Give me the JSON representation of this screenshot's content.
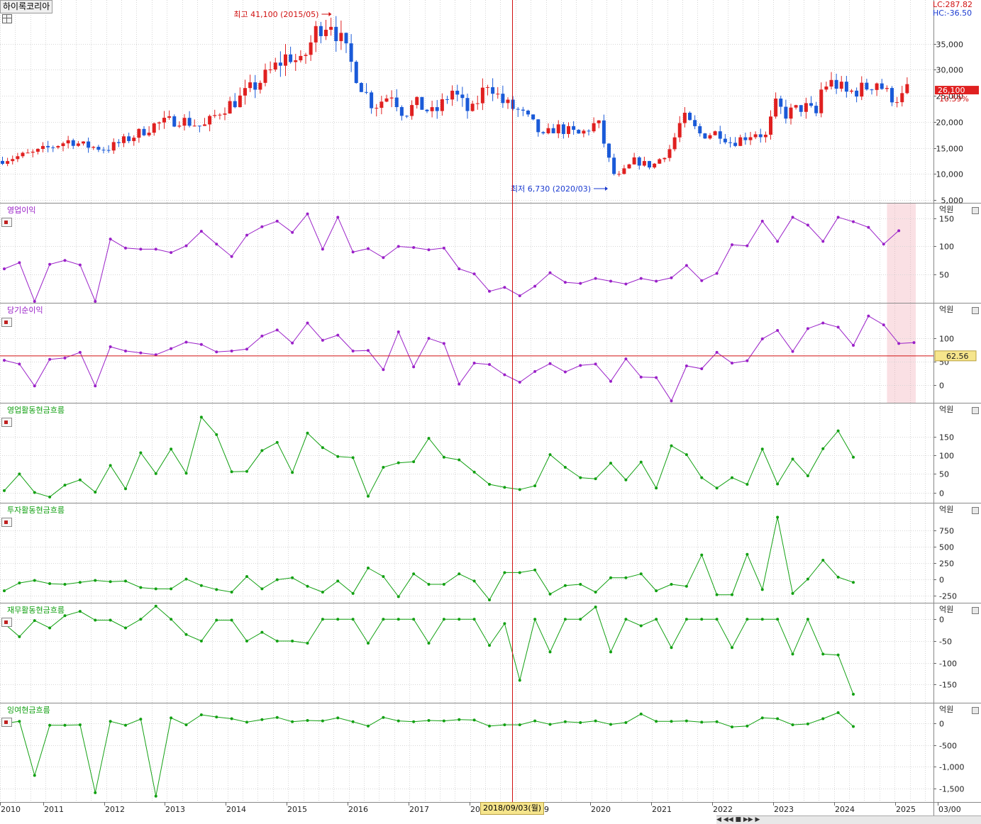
{
  "window": {
    "stock_name": "하이록코리아",
    "lc_label": "LC:287.82",
    "hc_label": "HC:-36.50",
    "crosshair_date": "2018/09/03(월)",
    "navigator_glyphs": "◀ ◀◀ ■ ▶▶ ▶"
  },
  "colors": {
    "up": "#e02020",
    "down": "#1a5ad8",
    "purple": "#9a20c8",
    "green": "#12a012",
    "crosshair": "#d01010",
    "grid": "#d6d6d6",
    "highlight": "rgba(240,160,170,0.32)"
  },
  "chart_data": [
    {
      "type": "candlestick",
      "title": "하이록코리아",
      "unit": "원",
      "ylim": [
        5000,
        41500
      ],
      "yticks": [
        5000,
        10000,
        15000,
        20000,
        25000,
        30000,
        35000
      ],
      "ytick_labels": [
        "5,000",
        "10,000",
        "15,000",
        "20,000",
        "25,000",
        "30,000",
        "35,000"
      ],
      "current_price_label": "26,100",
      "current_change_label": "10.59%",
      "high_annotation": "최고 41,100 (2015/05)",
      "low_annotation": "최저 6,730 (2020/03)",
      "x_labels": [
        "2010",
        "2011",
        "2012",
        "2013",
        "2014",
        "2015",
        "2016",
        "2017",
        "20",
        "9",
        "2020",
        "2021",
        "2022",
        "2023",
        "2024",
        "2025",
        "03/00"
      ],
      "crosshair_date": "2018/09/03(월)",
      "close_keys": [
        [
          2010.0,
          12500
        ],
        [
          2010.6,
          14000
        ],
        [
          2011.2,
          16500
        ],
        [
          2011.4,
          15500
        ],
        [
          2011.8,
          14800
        ],
        [
          2012.2,
          17000
        ],
        [
          2012.6,
          19500
        ],
        [
          2013.0,
          20500
        ],
        [
          2013.4,
          19000
        ],
        [
          2013.7,
          22500
        ],
        [
          2014.0,
          24500
        ],
        [
          2014.4,
          28500
        ],
        [
          2014.8,
          33000
        ],
        [
          2015.0,
          31000
        ],
        [
          2015.3,
          38500
        ],
        [
          2015.5,
          39500
        ],
        [
          2015.8,
          32000
        ],
        [
          2016.0,
          27000
        ],
        [
          2016.2,
          23000
        ],
        [
          2016.5,
          25500
        ],
        [
          2016.7,
          21500
        ],
        [
          2016.9,
          23500
        ],
        [
          2017.2,
          21500
        ],
        [
          2017.5,
          26000
        ],
        [
          2017.8,
          21500
        ],
        [
          2018.1,
          28000
        ],
        [
          2018.3,
          24000
        ],
        [
          2018.6,
          22000
        ],
        [
          2018.8,
          20000
        ],
        [
          2019.0,
          17000
        ],
        [
          2019.2,
          19000
        ],
        [
          2019.6,
          17500
        ],
        [
          2019.9,
          20000
        ],
        [
          2020.1,
          12000
        ],
        [
          2020.2,
          9000
        ],
        [
          2020.5,
          12500
        ],
        [
          2020.8,
          11500
        ],
        [
          2021.1,
          15000
        ],
        [
          2021.3,
          21000
        ],
        [
          2021.6,
          17500
        ],
        [
          2021.9,
          18000
        ],
        [
          2022.1,
          16000
        ],
        [
          2022.5,
          18000
        ],
        [
          2022.7,
          17000
        ],
        [
          2022.8,
          23500
        ],
        [
          2023.0,
          21500
        ],
        [
          2023.3,
          23000
        ],
        [
          2023.5,
          21500
        ],
        [
          2023.6,
          27000
        ],
        [
          2023.8,
          27500
        ],
        [
          2024.0,
          25500
        ],
        [
          2024.3,
          26500
        ],
        [
          2024.5,
          27800
        ],
        [
          2024.7,
          25000
        ],
        [
          2024.9,
          24500
        ],
        [
          2025.0,
          26100
        ]
      ]
    },
    {
      "type": "line",
      "title": "영업이익",
      "unit": "억원",
      "color": "#9a20c8",
      "ylim": [
        2,
        160
      ],
      "yticks": [
        50,
        100,
        150
      ],
      "highlight_last_period": true,
      "x": [
        2010.0,
        2010.25,
        2010.5,
        2010.75,
        2011.0,
        2011.25,
        2011.5,
        2011.75,
        2012.0,
        2012.25,
        2012.5,
        2012.75,
        2013.0,
        2013.25,
        2013.5,
        2013.75,
        2014.0,
        2014.25,
        2014.5,
        2014.75,
        2015.0,
        2015.25,
        2015.5,
        2015.75,
        2016.0,
        2016.25,
        2016.5,
        2016.75,
        2017.0,
        2017.25,
        2017.5,
        2017.75,
        2018.0,
        2018.25,
        2018.5,
        2018.75,
        2019.0,
        2019.25,
        2019.5,
        2019.75,
        2020.0,
        2020.25,
        2020.5,
        2020.75,
        2021.0,
        2021.25,
        2021.5,
        2021.75,
        2022.0,
        2022.25,
        2022.5,
        2022.75,
        2023.0,
        2023.25,
        2023.5,
        2023.75,
        2024.0,
        2024.25,
        2024.5,
        2024.75,
        2025.0
      ],
      "values": [
        60,
        71,
        2,
        68,
        75,
        67,
        2,
        113,
        97,
        95,
        95,
        89,
        101,
        127,
        104,
        82,
        120,
        135,
        145,
        125,
        158,
        95,
        152,
        90,
        96,
        80,
        100,
        98,
        94,
        97,
        60,
        51,
        20,
        27,
        12,
        29,
        53,
        36,
        34,
        43,
        38,
        33,
        43,
        38,
        44,
        66,
        39,
        52,
        103,
        101,
        145,
        109,
        152,
        138,
        109,
        152,
        144,
        134,
        104,
        128
      ]
    },
    {
      "type": "line",
      "title": "당기순이익",
      "unit": "억원",
      "color": "#9a20c8",
      "ylim": [
        -35,
        155
      ],
      "yticks": [
        0,
        50,
        100
      ],
      "highlight_last_period": true,
      "reference_value": 62.56,
      "reference_label": "62.56",
      "x": [
        2010.0,
        2010.25,
        2010.5,
        2010.75,
        2011.0,
        2011.25,
        2011.5,
        2011.75,
        2012.0,
        2012.25,
        2012.5,
        2012.75,
        2013.0,
        2013.25,
        2013.5,
        2013.75,
        2014.0,
        2014.25,
        2014.5,
        2014.75,
        2015.0,
        2015.25,
        2015.5,
        2015.75,
        2016.0,
        2016.25,
        2016.5,
        2016.75,
        2017.0,
        2017.25,
        2017.5,
        2017.75,
        2018.0,
        2018.25,
        2018.5,
        2018.75,
        2019.0,
        2019.25,
        2019.5,
        2019.75,
        2020.0,
        2020.25,
        2020.5,
        2020.75,
        2021.0,
        2021.25,
        2021.5,
        2021.75,
        2022.0,
        2022.25,
        2022.5,
        2022.75,
        2023.0,
        2023.25,
        2023.5,
        2023.75,
        2024.0,
        2024.25,
        2024.5,
        2024.75,
        2025.0
      ],
      "values": [
        53,
        45,
        -2,
        55,
        58,
        70,
        -2,
        82,
        73,
        69,
        65,
        78,
        92,
        87,
        71,
        73,
        77,
        105,
        118,
        90,
        133,
        96,
        107,
        73,
        74,
        33,
        114,
        39,
        100,
        89,
        2,
        47,
        44,
        22,
        6,
        29,
        46,
        28,
        42,
        45,
        8,
        56,
        17,
        16,
        -34,
        41,
        35,
        70,
        47,
        52,
        99,
        117,
        72,
        121,
        133,
        124,
        85,
        148,
        129,
        89,
        91
      ]
    },
    {
      "type": "line",
      "title": "영업활동현금흐름",
      "unit": "억원",
      "color": "#12a012",
      "ylim": [
        -20,
        215
      ],
      "yticks": [
        0,
        50,
        100,
        150
      ],
      "x": [
        2010.0,
        2010.25,
        2010.5,
        2010.75,
        2011.0,
        2011.25,
        2011.5,
        2011.75,
        2012.0,
        2012.25,
        2012.5,
        2012.75,
        2013.0,
        2013.25,
        2013.5,
        2013.75,
        2014.0,
        2014.25,
        2014.5,
        2014.75,
        2015.0,
        2015.25,
        2015.5,
        2015.75,
        2016.0,
        2016.25,
        2016.5,
        2016.75,
        2017.0,
        2017.25,
        2017.5,
        2017.75,
        2018.0,
        2018.25,
        2018.5,
        2018.75,
        2019.0,
        2019.25,
        2019.5,
        2019.75,
        2020.0,
        2020.25,
        2020.5,
        2020.75,
        2021.0,
        2021.25,
        2021.5,
        2021.75,
        2022.0,
        2022.25,
        2022.5,
        2022.75,
        2023.0,
        2023.25,
        2023.5,
        2023.75,
        2024.0,
        2024.25,
        2024.5,
        2024.75
      ],
      "values": [
        5,
        50,
        0,
        -12,
        20,
        34,
        1,
        73,
        10,
        107,
        51,
        117,
        52,
        203,
        156,
        56,
        57,
        113,
        135,
        54,
        160,
        121,
        97,
        94,
        -10,
        68,
        80,
        83,
        146,
        95,
        88,
        55,
        22,
        14,
        8,
        18,
        102,
        68,
        40,
        37,
        79,
        34,
        82,
        12,
        126,
        102,
        40,
        12,
        40,
        22,
        117,
        23,
        90,
        45,
        118,
        166,
        95
      ]
    },
    {
      "type": "line",
      "title": "투자활동현금흐름",
      "unit": "억원",
      "color": "#12a012",
      "ylim": [
        -320,
        1020
      ],
      "yticks": [
        -250,
        0,
        250,
        500,
        750
      ],
      "x": [
        2010.0,
        2010.25,
        2010.5,
        2010.75,
        2011.0,
        2011.25,
        2011.5,
        2011.75,
        2012.0,
        2012.25,
        2012.5,
        2012.75,
        2013.0,
        2013.25,
        2013.5,
        2013.75,
        2014.0,
        2014.25,
        2014.5,
        2014.75,
        2015.0,
        2015.25,
        2015.5,
        2015.75,
        2016.0,
        2016.25,
        2016.5,
        2016.75,
        2017.0,
        2017.25,
        2017.5,
        2017.75,
        2018.0,
        2018.25,
        2018.5,
        2018.75,
        2019.0,
        2019.25,
        2019.5,
        2019.75,
        2020.0,
        2020.25,
        2020.5,
        2020.75,
        2021.0,
        2021.25,
        2021.5,
        2021.75,
        2022.0,
        2022.25,
        2022.5,
        2022.75,
        2023.0,
        2023.25,
        2023.5,
        2023.75,
        2024.0,
        2024.25,
        2024.5,
        2024.75
      ],
      "values": [
        -180,
        -60,
        -20,
        -70,
        -80,
        -50,
        -20,
        -40,
        -30,
        -130,
        -150,
        -150,
        0,
        -100,
        -160,
        -200,
        40,
        -150,
        -10,
        20,
        -110,
        -200,
        -30,
        -220,
        170,
        40,
        -270,
        80,
        -80,
        -80,
        80,
        -30,
        -320,
        100,
        100,
        140,
        -230,
        -100,
        -80,
        -200,
        20,
        20,
        80,
        -180,
        -80,
        -110,
        370,
        -240,
        -240,
        380,
        -160,
        950,
        -220,
        0,
        290,
        30,
        -50
      ]
    },
    {
      "type": "line",
      "title": "재무활동현금흐름",
      "unit": "억원",
      "color": "#12a012",
      "ylim": [
        -185,
        15
      ],
      "yticks": [
        -150,
        -100,
        -50,
        0
      ],
      "x": [
        2010.0,
        2010.25,
        2010.5,
        2010.75,
        2011.0,
        2011.25,
        2011.5,
        2011.75,
        2012.0,
        2012.25,
        2012.5,
        2012.75,
        2013.0,
        2013.25,
        2013.5,
        2013.75,
        2014.0,
        2014.25,
        2014.5,
        2014.75,
        2015.0,
        2015.25,
        2015.5,
        2015.75,
        2016.0,
        2016.25,
        2016.5,
        2016.75,
        2017.0,
        2017.25,
        2017.5,
        2017.75,
        2018.0,
        2018.25,
        2018.5,
        2018.75,
        2019.0,
        2019.25,
        2019.5,
        2019.75,
        2020.0,
        2020.25,
        2020.5,
        2020.75,
        2021.0,
        2021.25,
        2021.5,
        2021.75,
        2022.0,
        2022.25,
        2022.5,
        2022.75,
        2023.0,
        2023.25,
        2023.5,
        2023.75,
        2024.0,
        2024.25,
        2024.5,
        2024.75
      ],
      "values": [
        -10,
        -40,
        -3,
        -20,
        8,
        18,
        -2,
        -2,
        -20,
        0,
        30,
        0,
        -35,
        -50,
        -2,
        -2,
        -50,
        -30,
        -50,
        -50,
        -55,
        0,
        0,
        0,
        -55,
        0,
        0,
        0,
        -55,
        0,
        0,
        0,
        -60,
        -10,
        -140,
        0,
        -75,
        0,
        0,
        28,
        -75,
        0,
        -15,
        0,
        -65,
        0,
        0,
        0,
        -65,
        0,
        0,
        0,
        -80,
        0,
        -80,
        -82,
        -172
      ]
    },
    {
      "type": "line",
      "title": "잉여현금흐름",
      "unit": "억원",
      "color": "#12a012",
      "ylim": [
        -1750,
        250
      ],
      "yticks": [
        -1500,
        -1000,
        -500,
        0
      ],
      "x": [
        2010.0,
        2010.25,
        2010.5,
        2010.75,
        2011.0,
        2011.25,
        2011.5,
        2011.75,
        2012.0,
        2012.25,
        2012.5,
        2012.75,
        2013.0,
        2013.25,
        2013.5,
        2013.75,
        2014.0,
        2014.25,
        2014.5,
        2014.75,
        2015.0,
        2015.25,
        2015.5,
        2015.75,
        2016.0,
        2016.25,
        2016.5,
        2016.75,
        2017.0,
        2017.25,
        2017.5,
        2017.75,
        2018.0,
        2018.25,
        2018.5,
        2018.75,
        2019.0,
        2019.25,
        2019.5,
        2019.75,
        2020.0,
        2020.25,
        2020.5,
        2020.75,
        2021.0,
        2021.25,
        2021.5,
        2021.75,
        2022.0,
        2022.25,
        2022.5,
        2022.75,
        2023.0,
        2023.25,
        2023.5,
        2023.75,
        2024.0,
        2024.25,
        2024.5,
        2024.75
      ],
      "values": [
        0,
        50,
        -1200,
        -40,
        -40,
        -30,
        -1600,
        50,
        -40,
        100,
        -1680,
        130,
        -30,
        200,
        150,
        110,
        30,
        90,
        140,
        40,
        70,
        60,
        130,
        40,
        -60,
        140,
        60,
        40,
        70,
        60,
        90,
        80,
        -60,
        -30,
        -30,
        60,
        -20,
        40,
        20,
        60,
        -20,
        20,
        220,
        50,
        50,
        60,
        30,
        40,
        -80,
        -60,
        130,
        110,
        -30,
        -10,
        110,
        250,
        -70
      ]
    }
  ]
}
